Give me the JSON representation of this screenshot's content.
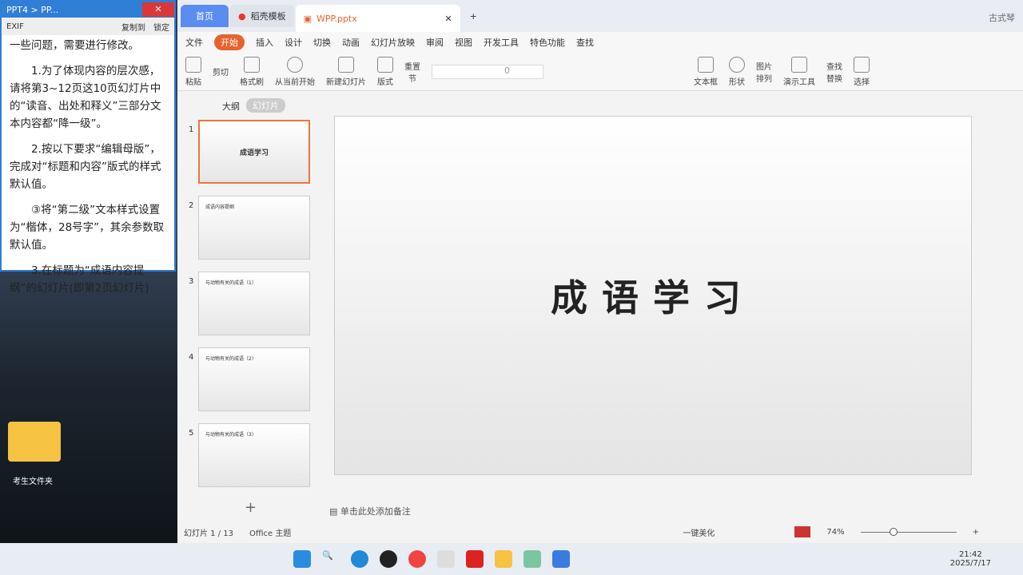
{
  "side": {
    "title": "PPT4 > PP...",
    "exif": "EXIF",
    "copy": "复制到",
    "lock": "锁定",
    "paras": [
      "一些问题，需要进行修改。",
      "1.为了体现内容的层次感，请将第3~12页这10页幻灯片中的“读音、出处和释义”三部分文本内容都“降一级”。",
      "2.按以下要求“编辑母版”，完成对“标题和内容”版式的样式默认值。",
      "③将“第二级”文本样式设置为“楷体，28号字”，其余参数取默认值。",
      "3.在标题为“成语内容提纲”的幻灯片(即第2页幻灯片)"
    ]
  },
  "desktop": {
    "folder": "考生文件夹"
  },
  "tabs": {
    "home": "首页",
    "template": "稻壳模板",
    "file": "WPP.pptx",
    "user": "古式琴"
  },
  "menu": [
    "文件",
    "开始",
    "插入",
    "设计",
    "切换",
    "动画",
    "幻灯片放映",
    "审阅",
    "视图",
    "开发工具",
    "特色功能",
    "查找"
  ],
  "ribbon": [
    "粘贴",
    "剪切",
    "格式刷",
    "从当前开始",
    "新建幻灯片",
    "版式",
    "节",
    "重置",
    "文本框",
    "形状",
    "排列",
    "图片",
    "演示工具",
    "替换",
    "选择"
  ],
  "font_size": "0",
  "panel": {
    "outline": "大纲",
    "slides": "幻灯片"
  },
  "thumbs": [
    {
      "n": "1",
      "t": "成语学习"
    },
    {
      "n": "2",
      "t": "成语内容提纲"
    },
    {
      "n": "3",
      "t": "与动物有关的成语（1）"
    },
    {
      "n": "4",
      "t": "与动物有关的成语（2）"
    },
    {
      "n": "5",
      "t": "与动物有关的成语（3）"
    }
  ],
  "slide_title": "成语学习",
  "notes": "单击此处添加备注",
  "status": {
    "slide": "幻灯片 1 / 13",
    "theme": "Office 主题",
    "beautify": "一键美化",
    "zoom": "74%"
  },
  "clock": {
    "time": "21:42",
    "date": "2025/7/17"
  }
}
